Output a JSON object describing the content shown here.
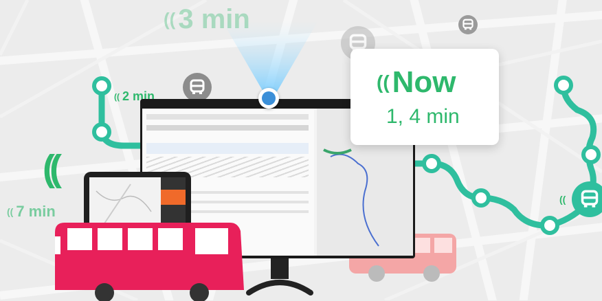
{
  "colors": {
    "accent_green": "#2eb86c",
    "route_teal": "#2fbf9e",
    "bus_red": "#e8205a",
    "bus_pink": "#f4a6a6",
    "pin_grey": "#8c8c8c",
    "locator_blue": "#3b8fd8"
  },
  "eta_labels": {
    "top": "3 min",
    "left_upper": "2 min",
    "left_lower": "7 min"
  },
  "popup": {
    "primary": "Now",
    "secondary": "1, 4 min",
    "icon": "signal-wave-icon"
  },
  "icons": {
    "bus_stop": "bus-icon",
    "arrival_signal": "signal-wave-icon",
    "location": "location-dot-icon"
  }
}
